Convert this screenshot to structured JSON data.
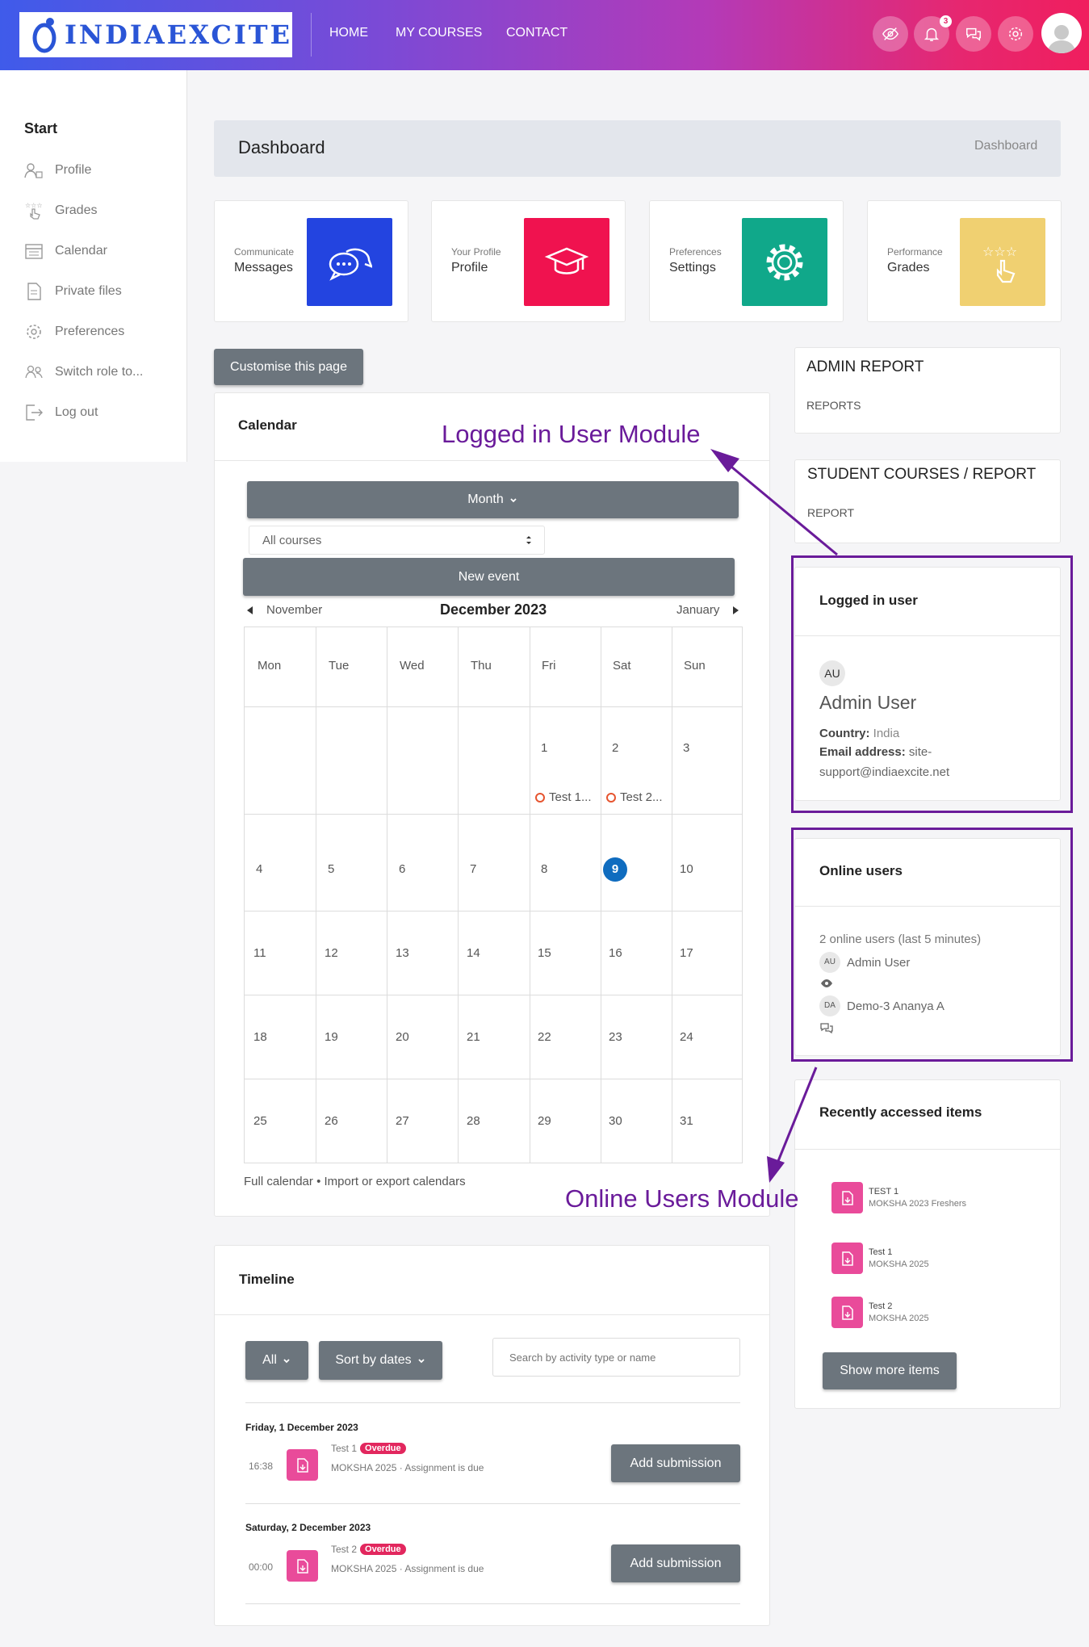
{
  "header": {
    "logo_text": "INDIAEXCITE",
    "nav": [
      "HOME",
      "MY COURSES",
      "CONTACT"
    ],
    "notification_count": "3"
  },
  "sidebar": {
    "title": "Start",
    "items": [
      {
        "label": "Profile",
        "icon": "profile-icon"
      },
      {
        "label": "Grades",
        "icon": "grades-icon"
      },
      {
        "label": "Calendar",
        "icon": "calendar-icon"
      },
      {
        "label": "Private files",
        "icon": "file-icon"
      },
      {
        "label": "Preferences",
        "icon": "gear-icon"
      },
      {
        "label": "Switch role to...",
        "icon": "users-icon"
      },
      {
        "label": "Log out",
        "icon": "logout-icon"
      }
    ]
  },
  "page": {
    "title": "Dashboard",
    "breadcrumb": "Dashboard"
  },
  "tiles": [
    {
      "subtitle": "Communicate",
      "title": "Messages",
      "color": "#2344e0"
    },
    {
      "subtitle": "Your Profile",
      "title": "Profile",
      "color": "#f0124f"
    },
    {
      "subtitle": "Preferences",
      "title": "Settings",
      "color": "#10a88a"
    },
    {
      "subtitle": "Performance",
      "title": "Grades",
      "color": "#f0d071"
    }
  ],
  "customise_button": "Customise this page",
  "calendar": {
    "title": "Calendar",
    "view_button": "Month",
    "course_filter": "All courses",
    "new_event": "New event",
    "prev_month": "November",
    "current_month": "December 2023",
    "next_month": "January",
    "weekdays": [
      "Mon",
      "Tue",
      "Wed",
      "Thu",
      "Fri",
      "Sat",
      "Sun"
    ],
    "weeks": [
      [
        "",
        "",
        "",
        "",
        "1",
        "2",
        "3"
      ],
      [
        "4",
        "5",
        "6",
        "7",
        "8",
        "9",
        "10"
      ],
      [
        "11",
        "12",
        "13",
        "14",
        "15",
        "16",
        "17"
      ],
      [
        "18",
        "19",
        "20",
        "21",
        "22",
        "23",
        "24"
      ],
      [
        "25",
        "26",
        "27",
        "28",
        "29",
        "30",
        "31"
      ]
    ],
    "today": "9",
    "events": [
      {
        "day": "1",
        "label": "Test 1..."
      },
      {
        "day": "2",
        "label": "Test 2..."
      }
    ],
    "footer_full": "Full calendar",
    "footer_sep": "•",
    "footer_import": "Import or export calendars"
  },
  "timeline": {
    "title": "Timeline",
    "filter_button": "All",
    "sort_button": "Sort by dates",
    "search_placeholder": "Search by activity type or name",
    "groups": [
      {
        "date": "Friday, 1 December 2023",
        "time": "16:38",
        "name": "Test 1",
        "badge": "Overdue",
        "detail": "MOKSHA 2025 · Assignment is due",
        "action": "Add submission"
      },
      {
        "date": "Saturday, 2 December 2023",
        "time": "00:00",
        "name": "Test 2",
        "badge": "Overdue",
        "detail": "MOKSHA 2025 · Assignment is due",
        "action": "Add submission"
      }
    ]
  },
  "admin_report": {
    "title": "ADMIN REPORT",
    "link": "REPORTS"
  },
  "student_report": {
    "title": "STUDENT COURSES / REPORT",
    "link": "REPORT"
  },
  "logged_in_user": {
    "title": "Logged in user",
    "initials": "AU",
    "name": "Admin User",
    "country_label": "Country:",
    "country": "India",
    "email_label": "Email address:",
    "email_line1": "site-",
    "email_line2": "support@indiaexcite.net"
  },
  "online_users": {
    "title": "Online users",
    "summary": "2 online users (last 5 minutes)",
    "users": [
      {
        "initials": "AU",
        "name": "Admin User"
      },
      {
        "initials": "DA",
        "name": "Demo-3 Ananya A"
      }
    ]
  },
  "recent_items": {
    "title": "Recently accessed items",
    "items": [
      {
        "name": "TEST 1",
        "course": "MOKSHA 2023 Freshers"
      },
      {
        "name": "Test 1",
        "course": "MOKSHA 2025"
      },
      {
        "name": "Test 2",
        "course": "MOKSHA 2025"
      }
    ],
    "more_button": "Show more items"
  },
  "annotations": {
    "logged_in_module": "Logged in User Module",
    "online_users_module": "Online Users Module",
    "color": "#6a1b9a"
  }
}
